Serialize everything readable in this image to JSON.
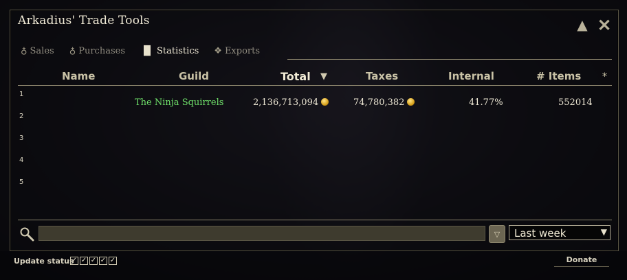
{
  "window": {
    "title": "Arkadius' Trade Tools"
  },
  "tabs": [
    {
      "label": "Sales",
      "icon": "money-bag-icon",
      "active": false
    },
    {
      "label": "Purchases",
      "icon": "money-bag-icon",
      "active": false
    },
    {
      "label": "Statistics",
      "icon": "bar-chart-icon",
      "active": true
    },
    {
      "label": "Exports",
      "icon": "export-icon",
      "active": false
    }
  ],
  "table": {
    "columns": {
      "name": "Name",
      "guild": "Guild",
      "total": "Total",
      "taxes": "Taxes",
      "internal": "Internal",
      "items": "# Items",
      "extra": "*"
    },
    "sort_indicator": "▼",
    "rows": [
      {
        "num": "1",
        "name": "",
        "guild": "The Ninja Squirrels",
        "total": "2,136,713,094",
        "taxes": "74,780,382",
        "internal": "41.77%",
        "items": "552014"
      },
      {
        "num": "2"
      },
      {
        "num": "3"
      },
      {
        "num": "4"
      },
      {
        "num": "5"
      }
    ]
  },
  "search": {
    "value": "",
    "placeholder": ""
  },
  "period_select": {
    "selected": "Last week",
    "arrow": "▼"
  },
  "filter_button": {
    "glyph": "▽"
  },
  "status": {
    "label": "Update status",
    "checks": [
      "✓",
      "✓",
      "✓",
      "✓",
      "✓"
    ]
  },
  "donate_label": "Donate",
  "colors": {
    "guild_name": "#6fe06a",
    "gold_coin": "#d9a21c",
    "frame_line": "#8e876e"
  }
}
